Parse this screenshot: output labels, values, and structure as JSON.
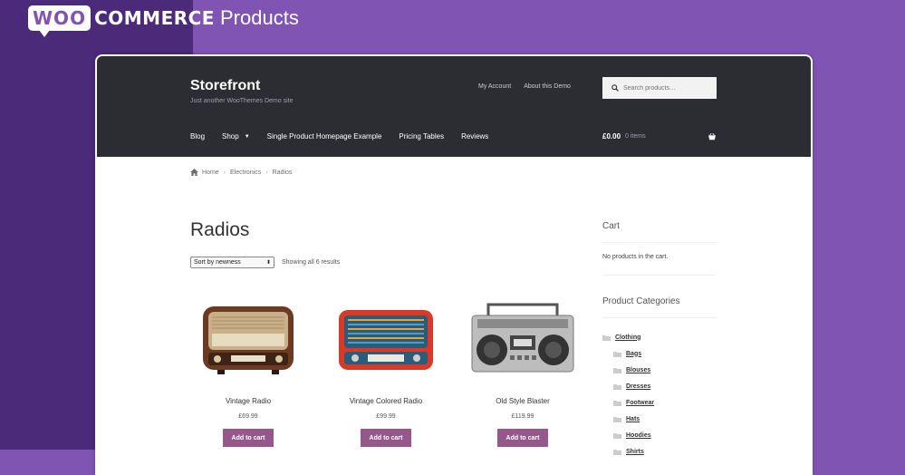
{
  "brand": {
    "logo_woo": "WOO",
    "logo_commerce": "COMMERCE",
    "page_heading": "Products"
  },
  "site": {
    "title": "Storefront",
    "tagline": "Just another WooThemes Demo site",
    "secondary_nav": [
      "My Account",
      "About this Demo"
    ],
    "search_placeholder": "Search products…",
    "primary_nav": [
      "Blog",
      "Shop",
      "Single Product Homepage Example",
      "Pricing Tables",
      "Reviews"
    ],
    "cart_amount": "£0.00",
    "cart_items": "0 items"
  },
  "breadcrumb": {
    "home": "Home",
    "level1": "Electronics",
    "level2": "Radios"
  },
  "main": {
    "title": "Radios",
    "sort_selected": "Sort by newness",
    "result_count": "Showing all 6 results",
    "add_to_cart_label": "Add to cart",
    "products": [
      {
        "name": "Vintage Radio",
        "price": "£69.99"
      },
      {
        "name": "Vintage Colored Radio",
        "price": "£99.99"
      },
      {
        "name": "Old Style Blaster",
        "price": "£119.99"
      }
    ]
  },
  "sidebar": {
    "cart_title": "Cart",
    "cart_empty": "No products in the cart.",
    "categories_title": "Product Categories",
    "categories": [
      {
        "label": "Clothing",
        "level": 0
      },
      {
        "label": "Bags",
        "level": 1
      },
      {
        "label": "Blouses",
        "level": 1
      },
      {
        "label": "Dresses",
        "level": 1
      },
      {
        "label": "Footwear",
        "level": 1
      },
      {
        "label": "Hats",
        "level": 1
      },
      {
        "label": "Hoodies",
        "level": 1
      },
      {
        "label": "Shirts",
        "level": 1
      }
    ]
  },
  "colors": {
    "woo_purple": "#7f54b3",
    "header_dark": "#2c2d33",
    "button": "#96588a"
  }
}
